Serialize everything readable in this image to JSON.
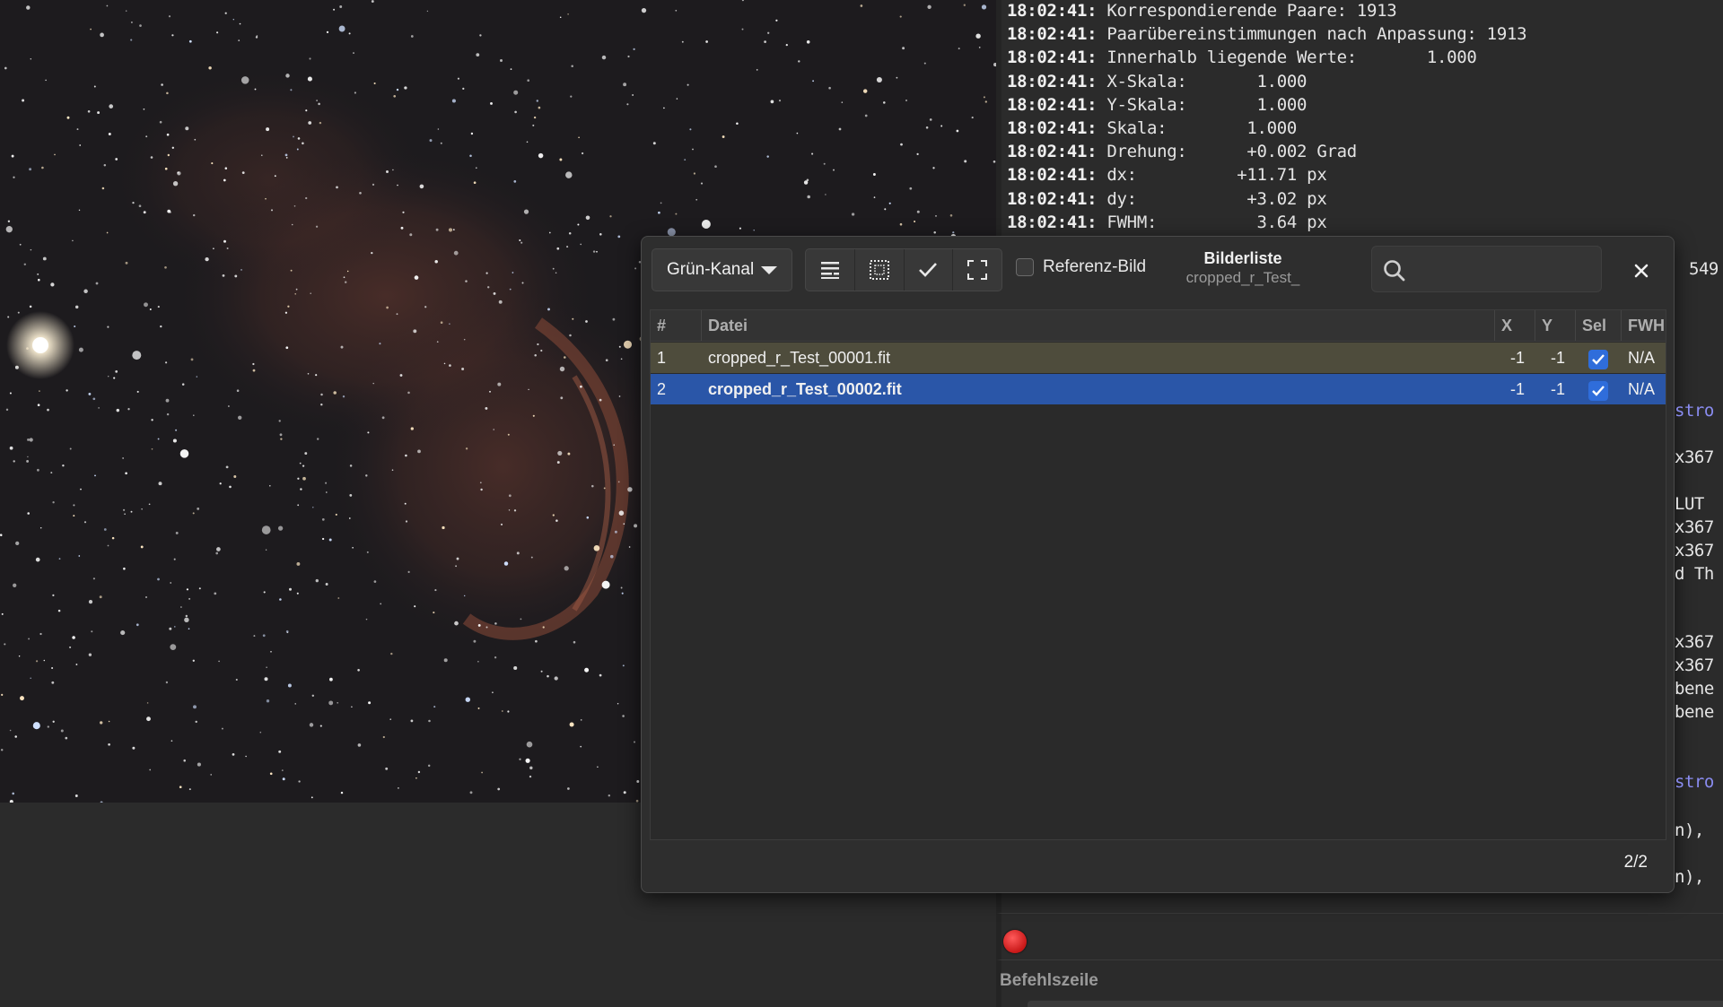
{
  "console": {
    "timestamp": "18:02:41:",
    "lines": [
      "Korrespondierende Paare: 1913",
      "Paarübereinstimmungen nach Anpassung: 1913",
      "Innerhalb liegende Werte:       1.000",
      "X-Skala:       1.000",
      "Y-Skala:       1.000",
      "Skala:        1.000",
      "Drehung:      +0.002 Grad",
      "dx:          +11.71 px",
      "dy:           +3.02 px",
      "FWHM:          3.64 px"
    ],
    "fragments": [
      "549",
      "stro",
      "x367",
      "LUT",
      "x367",
      "x367",
      "d Th",
      "x367",
      "x367",
      "bene",
      "bene",
      "stro",
      "n),",
      "n),"
    ],
    "command_label": "Befehlszeile"
  },
  "dialog": {
    "channel": "Grün-Kanal",
    "reference_label": "Referenz-Bild",
    "title": "Bilderliste",
    "subtitle": "cropped_r_Test_",
    "search_placeholder": "",
    "pager": "2/2",
    "columns": [
      "#",
      "Datei",
      "X",
      "Y",
      "Sel",
      "FWHM"
    ],
    "rows": [
      {
        "num": "1",
        "file": "cropped_r_Test_00001.fit",
        "x": "-1",
        "y": "-1",
        "selected": true,
        "fwhm": "N/A"
      },
      {
        "num": "2",
        "file": "cropped_r_Test_00002.fit",
        "x": "-1",
        "y": "-1",
        "selected": true,
        "fwhm": "N/A"
      }
    ]
  },
  "colors": {
    "row_highlight": "#4e4c3c",
    "row_selected": "#2a56a8",
    "checkbox": "#2f6ddb",
    "record": "#d42020"
  }
}
